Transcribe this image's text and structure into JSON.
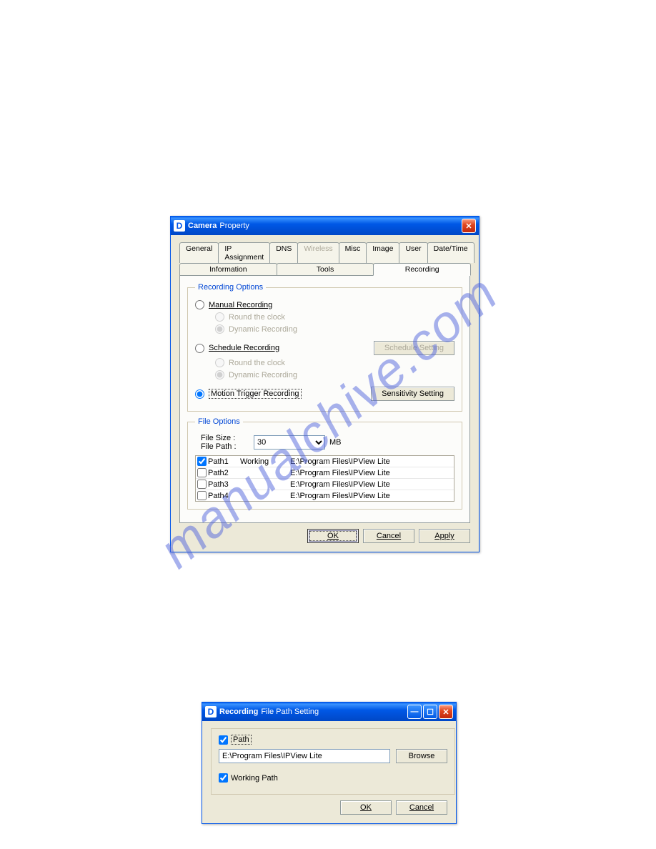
{
  "watermark": "manualchive.com",
  "win1": {
    "title_prefix": "D",
    "title_strong": "Camera",
    "title_rest": "Property",
    "tabs_row1": [
      "General",
      "IP Assignment",
      "DNS",
      "Wireless",
      "Misc",
      "Image",
      "User",
      "Date/Time"
    ],
    "tabs_row2": [
      "Information",
      "Tools",
      "Recording"
    ],
    "rec_opts_legend": "Recording Options",
    "manual_label": "Manual Recording",
    "round_label": "Round the clock",
    "dynamic_label": "Dynamic Recording",
    "schedule_label": "Schedule Recording",
    "schedule_btn": "Schedule Setting",
    "motion_label": "Motion Trigger Recording",
    "sensitivity_btn": "Sensitivity Setting",
    "file_opts_legend": "File Options",
    "file_size_label": "File Size :",
    "file_path_label": "File Path :",
    "file_size_value": "30",
    "mb": "MB",
    "paths": [
      {
        "name": "Path1",
        "status": "Working",
        "path": "E:\\Program Files\\IPView Lite",
        "checked": true
      },
      {
        "name": "Path2",
        "status": "",
        "path": "E:\\Program Files\\IPView Lite",
        "checked": false
      },
      {
        "name": "Path3",
        "status": "",
        "path": "E:\\Program Files\\IPView Lite",
        "checked": false
      },
      {
        "name": "Path4",
        "status": "",
        "path": "E:\\Program Files\\IPView Lite",
        "checked": false
      }
    ],
    "ok": "OK",
    "cancel": "Cancel",
    "apply": "Apply"
  },
  "win2": {
    "title_prefix": "D",
    "title_strong": "Recording",
    "title_rest": "File Path Setting",
    "path_chk": "Path",
    "path_value": "E:\\Program Files\\IPView Lite",
    "browse": "Browse",
    "working_path": "Working Path",
    "ok": "OK",
    "cancel": "Cancel"
  }
}
